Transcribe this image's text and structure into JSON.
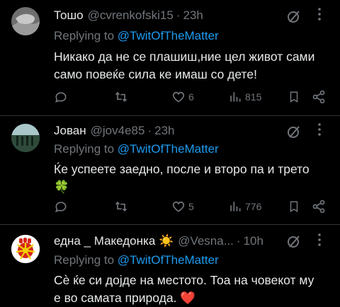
{
  "tweets": [
    {
      "name": "Тошо",
      "handle": "@cvrenkofski15",
      "separator": "·",
      "time": "23h",
      "reply_prefix": "Replying to",
      "reply_mention": "@TwitOfTheMatter",
      "text_line1": "Никако да не се плашиш,ние цел живот сами",
      "text_line2": "само повеќе сила ке имаш со дете!",
      "likes": "6",
      "views": "815"
    },
    {
      "name": "Јован",
      "handle": "@jov4e85",
      "separator": "·",
      "time": "23h",
      "reply_prefix": "Replying to",
      "reply_mention": "@TwitOfTheMatter",
      "text_line1": "Ќе успеете заедно, после и второ па и трето",
      "text_line2": "🍀",
      "likes": "5",
      "views": "776"
    },
    {
      "name": "една _ Македонка ☀️",
      "handle": "@Vesna...",
      "separator": "·",
      "time": "10h",
      "reply_prefix": "Replying to",
      "reply_mention": "@TwitOfTheMatter",
      "text_line1": "Сѐ ќе си дојде на местото. Тоа на човекот му",
      "text_line2": "е во самата природа. ❤️"
    }
  ],
  "icons": {
    "more": "more-icon",
    "grok": "grok-icon",
    "reply": "reply-icon",
    "retweet": "retweet-icon",
    "like": "like-icon",
    "views": "views-icon",
    "bookmark": "bookmark-icon",
    "share": "share-icon"
  },
  "colors": {
    "background": "#000000",
    "text": "#e7e9ea",
    "secondary": "#71767b",
    "accent": "#1d9bf0",
    "divider": "#2f3336"
  }
}
